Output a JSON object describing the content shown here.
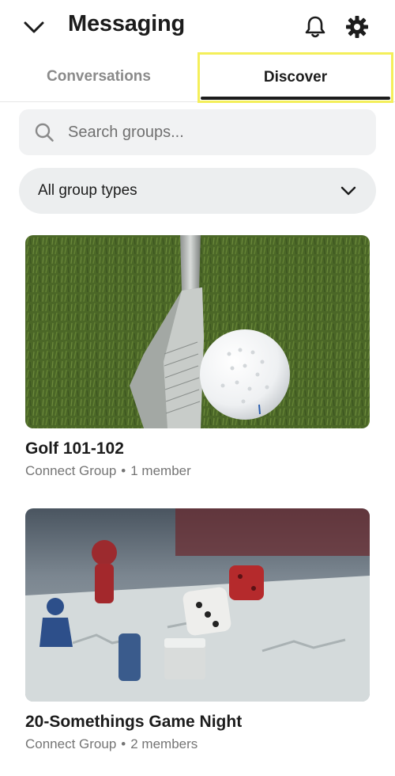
{
  "header": {
    "title": "Messaging",
    "back_icon": "chevron-down-icon",
    "notifications_icon": "bell-icon",
    "settings_icon": "gear-icon"
  },
  "tabs": [
    {
      "label": "Conversations",
      "selected": false
    },
    {
      "label": "Discover",
      "selected": true
    }
  ],
  "search": {
    "placeholder": "Search groups...",
    "value": ""
  },
  "filter": {
    "label": "All group types"
  },
  "groups": [
    {
      "title": "Golf 101-102",
      "type": "Connect Group",
      "separator": "•",
      "members": "1 member",
      "image": "golf club and golf ball on grass"
    },
    {
      "title": "20-Somethings Game Night",
      "type": "Connect Group",
      "separator": "•",
      "members": "2 members",
      "image": "board game pieces and dice"
    }
  ],
  "colors": {
    "highlight": "#f4ef5a",
    "text": "#1c1c1c",
    "muted": "#757575",
    "input_bg": "#f1f2f3"
  }
}
